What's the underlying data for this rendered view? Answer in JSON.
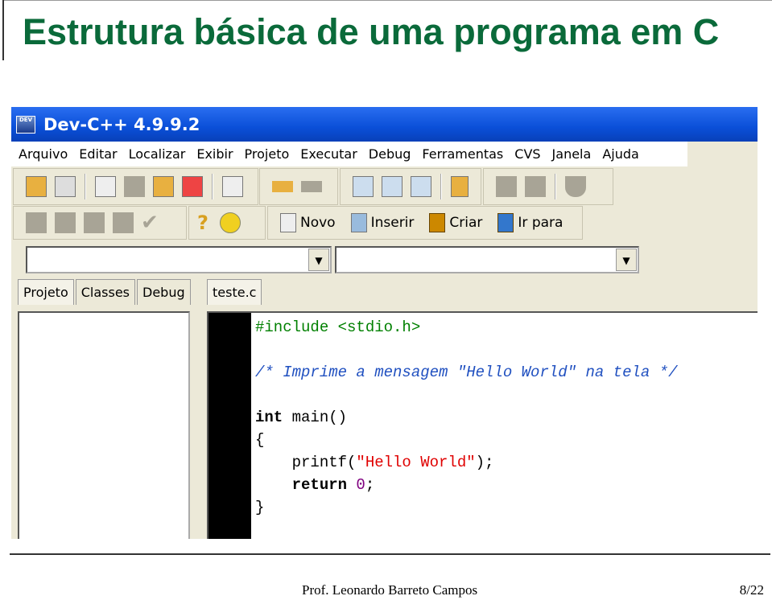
{
  "slide": {
    "title": "Estrutura básica de uma programa em C",
    "author": "Prof. Leonardo Barreto Campos",
    "page": "8/22",
    "title_color": "#0a6a3a"
  },
  "window": {
    "title": "Dev-C++ 4.9.9.2",
    "title_bar_color": "#0a4fd8",
    "menu": [
      "Arquivo",
      "Editar",
      "Localizar",
      "Exibir",
      "Projeto",
      "Executar",
      "Debug",
      "Ferramentas",
      "CVS",
      "Janela",
      "Ajuda"
    ],
    "toolbar2_buttons": [
      {
        "label": "Novo",
        "icon": "new-file-icon"
      },
      {
        "label": "Inserir",
        "icon": "insert-icon"
      },
      {
        "label": "Criar",
        "icon": "create-icon"
      },
      {
        "label": "Ir para",
        "icon": "goto-icon"
      }
    ],
    "left_tabs": [
      "Projeto",
      "Classes",
      "Debug"
    ],
    "editor_tab": "teste.c",
    "code": {
      "include": "#include <stdio.h>",
      "comment": "/* Imprime a mensagem \"Hello World\" na tela */",
      "int_kw": "int",
      "main_sig": " main()",
      "open_brace": "{",
      "printf_call": "    printf(",
      "hello_str": "\"Hello World\"",
      "printf_end": ");",
      "return_kw": "    return",
      "return_val": " 0",
      "semicolon": ";",
      "close_brace": "}"
    }
  }
}
